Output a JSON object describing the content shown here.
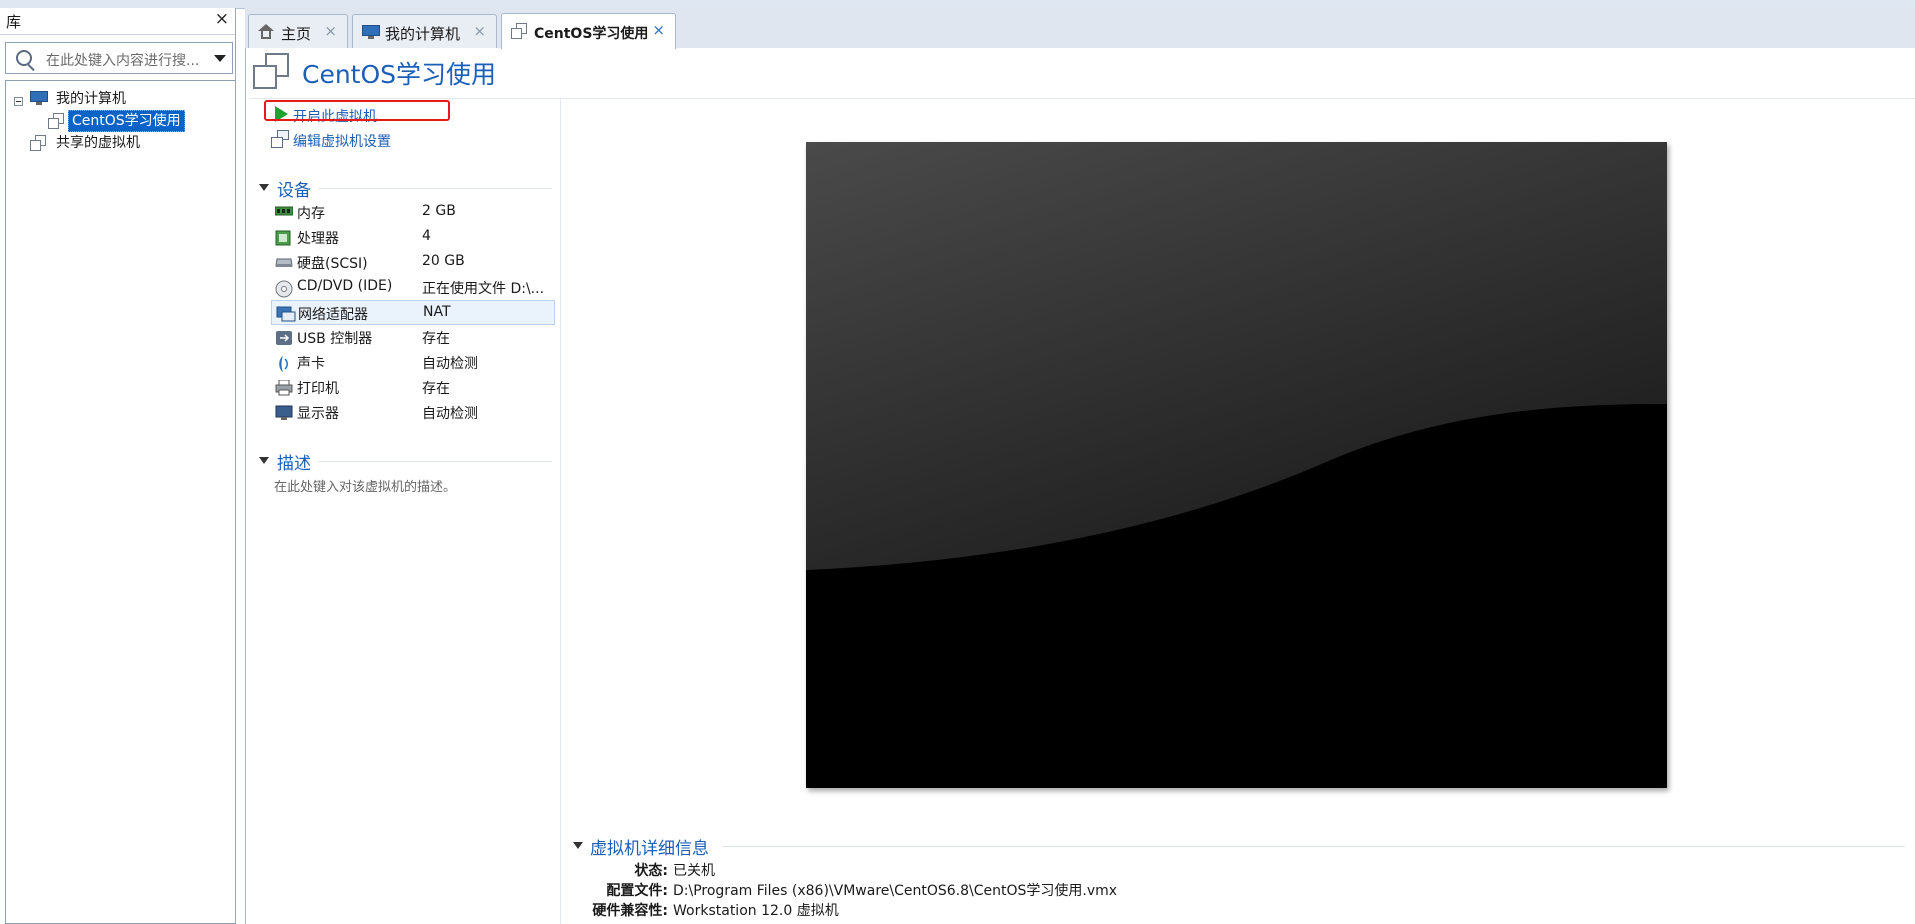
{
  "library": {
    "title": "库",
    "close": "×",
    "search_placeholder": "在此处键入内容进行搜...",
    "tree": {
      "my_computer": "我的计算机",
      "vm": "CentOS学习使用",
      "shared": "共享的虚拟机"
    }
  },
  "tabs": [
    {
      "label": "主页",
      "icon": "home-icon",
      "close": "×"
    },
    {
      "label": "我的计算机",
      "icon": "computer-icon",
      "close": "×"
    },
    {
      "label": "CentOS学习使用",
      "icon": "vm-icon",
      "close": "×",
      "active": true
    }
  ],
  "vm": {
    "title": "CentOS学习使用",
    "actions": {
      "power_on": "开启此虚拟机",
      "edit_settings": "编辑虚拟机设置"
    },
    "devices_section": "设备",
    "devices": [
      {
        "name": "内存",
        "value": "2 GB",
        "icon": "memory-icon"
      },
      {
        "name": "处理器",
        "value": "4",
        "icon": "processor-icon"
      },
      {
        "name": "硬盘(SCSI)",
        "value": "20 GB",
        "icon": "harddisk-icon"
      },
      {
        "name": "CD/DVD (IDE)",
        "value": "正在使用文件 D:\\...",
        "icon": "cdrom-icon"
      },
      {
        "name": "网络适配器",
        "value": "NAT",
        "icon": "network-icon"
      },
      {
        "name": "USB 控制器",
        "value": "存在",
        "icon": "usb-icon"
      },
      {
        "name": "声卡",
        "value": "自动检测",
        "icon": "sound-icon"
      },
      {
        "name": "打印机",
        "value": "存在",
        "icon": "printer-icon"
      },
      {
        "name": "显示器",
        "value": "自动检测",
        "icon": "display-icon"
      }
    ],
    "description_section": "描述",
    "description_placeholder": "在此处键入对该虚拟机的描述。",
    "details_section": "虚拟机详细信息",
    "details": [
      {
        "label": "状态:",
        "value": "已关机"
      },
      {
        "label": "配置文件:",
        "value": "D:\\Program Files (x86)\\VMware\\CentOS6.8\\CentOS学习使用.vmx"
      },
      {
        "label": "硬件兼容性:",
        "value": "Workstation 12.0 虚拟机"
      }
    ]
  },
  "colors": {
    "accent": "#1b5fb8",
    "selection": "#0a64c8",
    "play": "#1fa32d",
    "highlight_border": "#e81919"
  }
}
